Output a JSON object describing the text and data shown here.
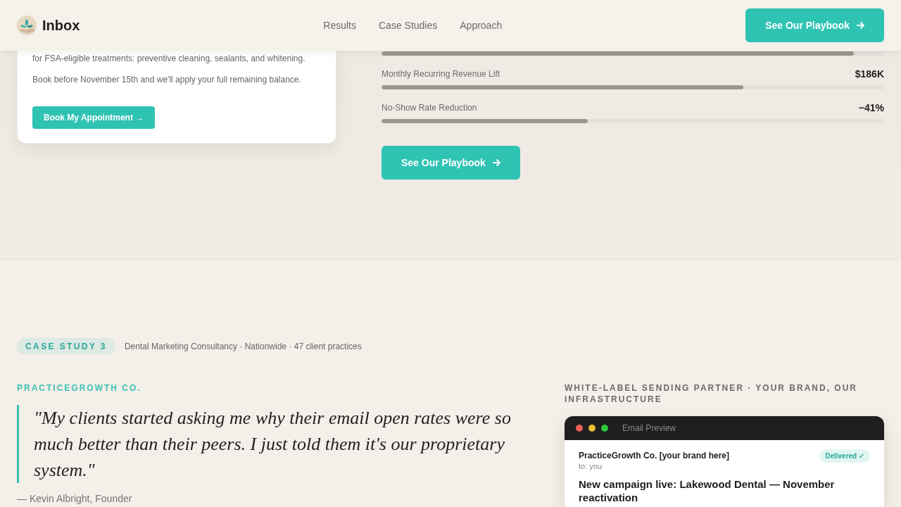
{
  "header": {
    "brand": "Inbox",
    "nav": [
      {
        "label": "Results"
      },
      {
        "label": "Case Studies"
      },
      {
        "label": "Approach"
      }
    ],
    "cta": "See Our Playbook"
  },
  "offer_card": {
    "paragraphs": [
      "for FSA-eligible treatments: preventive cleaning, sealants, and whitening.",
      "Book before November 15th and we'll apply your full remaining balance."
    ],
    "button": "Book My Appointment →"
  },
  "metrics": [
    {
      "level": 0.94
    },
    {
      "label": "Monthly Recurring Revenue Lift",
      "value": "$186K",
      "level": 0.72
    },
    {
      "label": "No-Show Rate Reduction",
      "value": "−41%",
      "level": 0.41
    }
  ],
  "playbook_button": "See Our Playbook",
  "case_study": {
    "badge": "CASE STUDY 3",
    "meta": "Dental Marketing Consultancy · Nationwide · 47 client practices",
    "client": "PRACTICEGROWTH CO.",
    "quote": "\"My clients started asking me why their email open rates were so much better than their peers. I just told them it's our proprietary system.\"",
    "attribution": "— Kevin Albright, Founder",
    "partner_heading": "WHITE-LABEL SENDING PARTNER · YOUR BRAND, OUR INFRASTRUCTURE",
    "email_preview": {
      "title": "Email Preview",
      "from": "PracticeGrowth Co. [your brand here]",
      "to": "to: you",
      "status": "Delivered ✓",
      "subject": "New campaign live: Lakewood Dental — November reactivation"
    }
  }
}
